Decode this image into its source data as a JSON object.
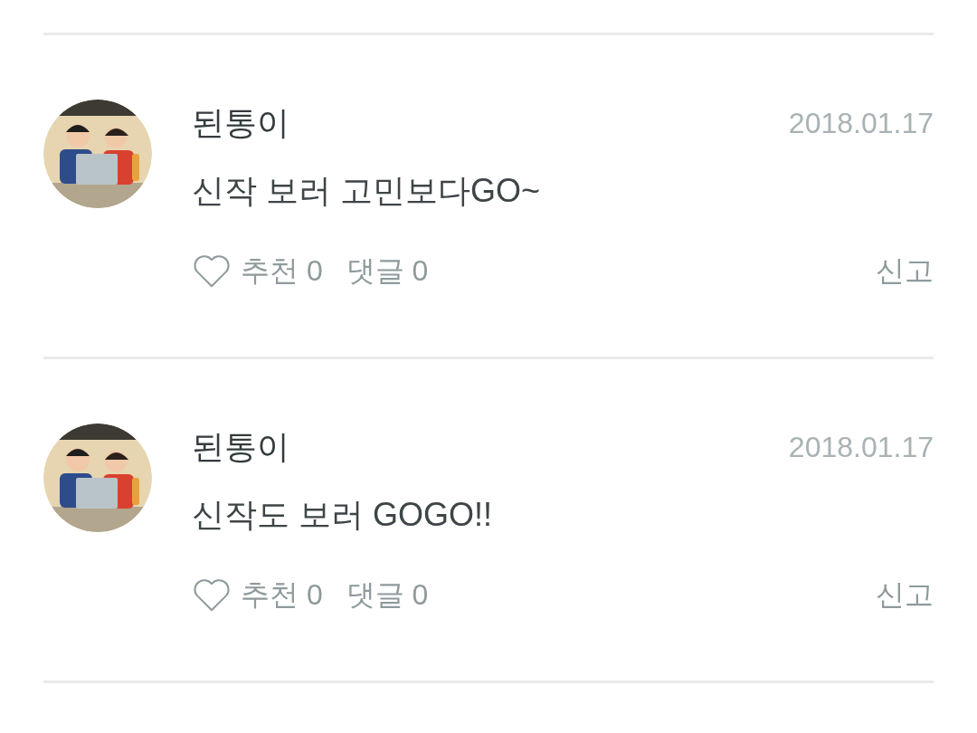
{
  "comments": [
    {
      "author": "된통이",
      "date": "2018.01.17",
      "text": "신작 보러 고민보다GO~",
      "liked": false,
      "like_label": "추천",
      "like_count": "0",
      "reply_label": "댓글",
      "reply_count": "0",
      "report": "신고"
    },
    {
      "author": "된통이",
      "date": "2018.01.17",
      "text": "신작도 보러 GOGO!!",
      "liked": false,
      "like_label": "추천",
      "like_count": "0",
      "reply_label": "댓글",
      "reply_count": "0",
      "report": "신고"
    }
  ]
}
